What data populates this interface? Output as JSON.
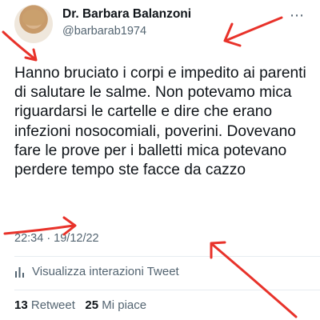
{
  "author": {
    "name": "Dr. Barbara Balanzoni",
    "handle": "@barbarab1974"
  },
  "tweet": {
    "text": "Hanno bruciato i corpi e impedito ai parenti di salutare le salme. Non potevamo mica riguardarsi  le cartelle e dire che erano infezioni nosocomiali, poverini. Dovevano fare le prove per i balletti mica potevano perdere tempo ste facce da cazzo",
    "timestamp": "22:34 · 19/12/22"
  },
  "analytics": {
    "label": "Visualizza interazioni Tweet"
  },
  "stats": {
    "retweets_count": "13",
    "retweets_label": "Retweet",
    "likes_count": "25",
    "likes_label": "Mi piace"
  },
  "colors": {
    "text": "#0f1419",
    "secondary": "#536471",
    "annotation_red": "#e8322a"
  },
  "icons": {
    "more": "more-icon",
    "analytics": "analytics-icon"
  }
}
